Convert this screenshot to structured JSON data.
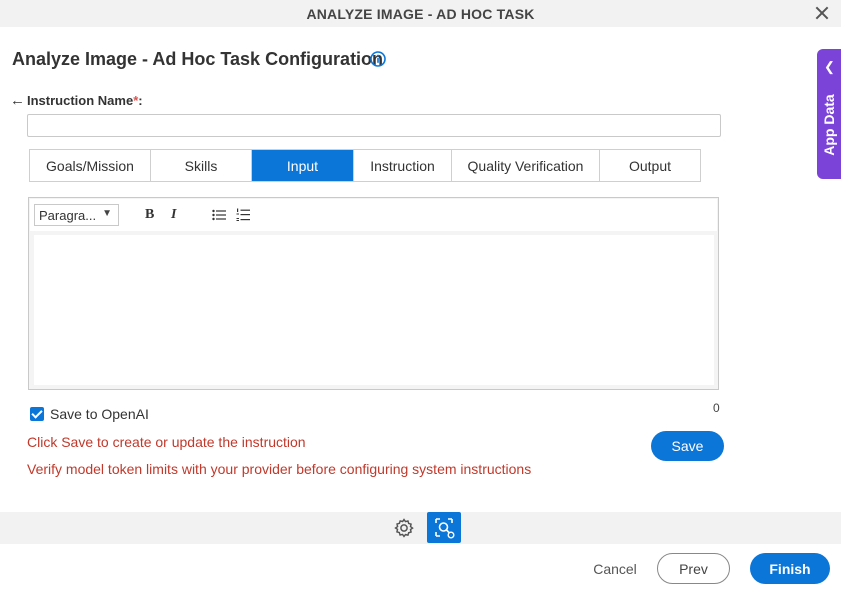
{
  "window": {
    "title": "ANALYZE IMAGE - AD HOC TASK"
  },
  "header": {
    "page_title": "Analyze Image - Ad Hoc Task Configuration"
  },
  "side_panel": {
    "label": "App Data"
  },
  "form": {
    "instruction_label": "Instruction Name",
    "required_mark": "*",
    "label_suffix": ":",
    "instruction_value": "",
    "tabs": [
      {
        "label": "Goals/Mission"
      },
      {
        "label": "Skills"
      },
      {
        "label": "Input"
      },
      {
        "label": "Instruction"
      },
      {
        "label": "Quality Verification"
      },
      {
        "label": "Output"
      }
    ],
    "active_tab": "Input"
  },
  "editor": {
    "paragraph_select": "Paragra...",
    "bold": "B",
    "italic": "I",
    "char_count": "0"
  },
  "options": {
    "save_to_openai_label": "Save to OpenAI",
    "save_to_openai_checked": true
  },
  "messages": {
    "line1": "Click Save to create or update the instruction",
    "line2": "Verify model token limits with your provider before configuring system instructions"
  },
  "buttons": {
    "save": "Save",
    "cancel": "Cancel",
    "prev": "Prev",
    "finish": "Finish"
  },
  "colors": {
    "accent": "#0b76d8",
    "side_tab": "#7b43d8",
    "message": "#c0392b"
  }
}
